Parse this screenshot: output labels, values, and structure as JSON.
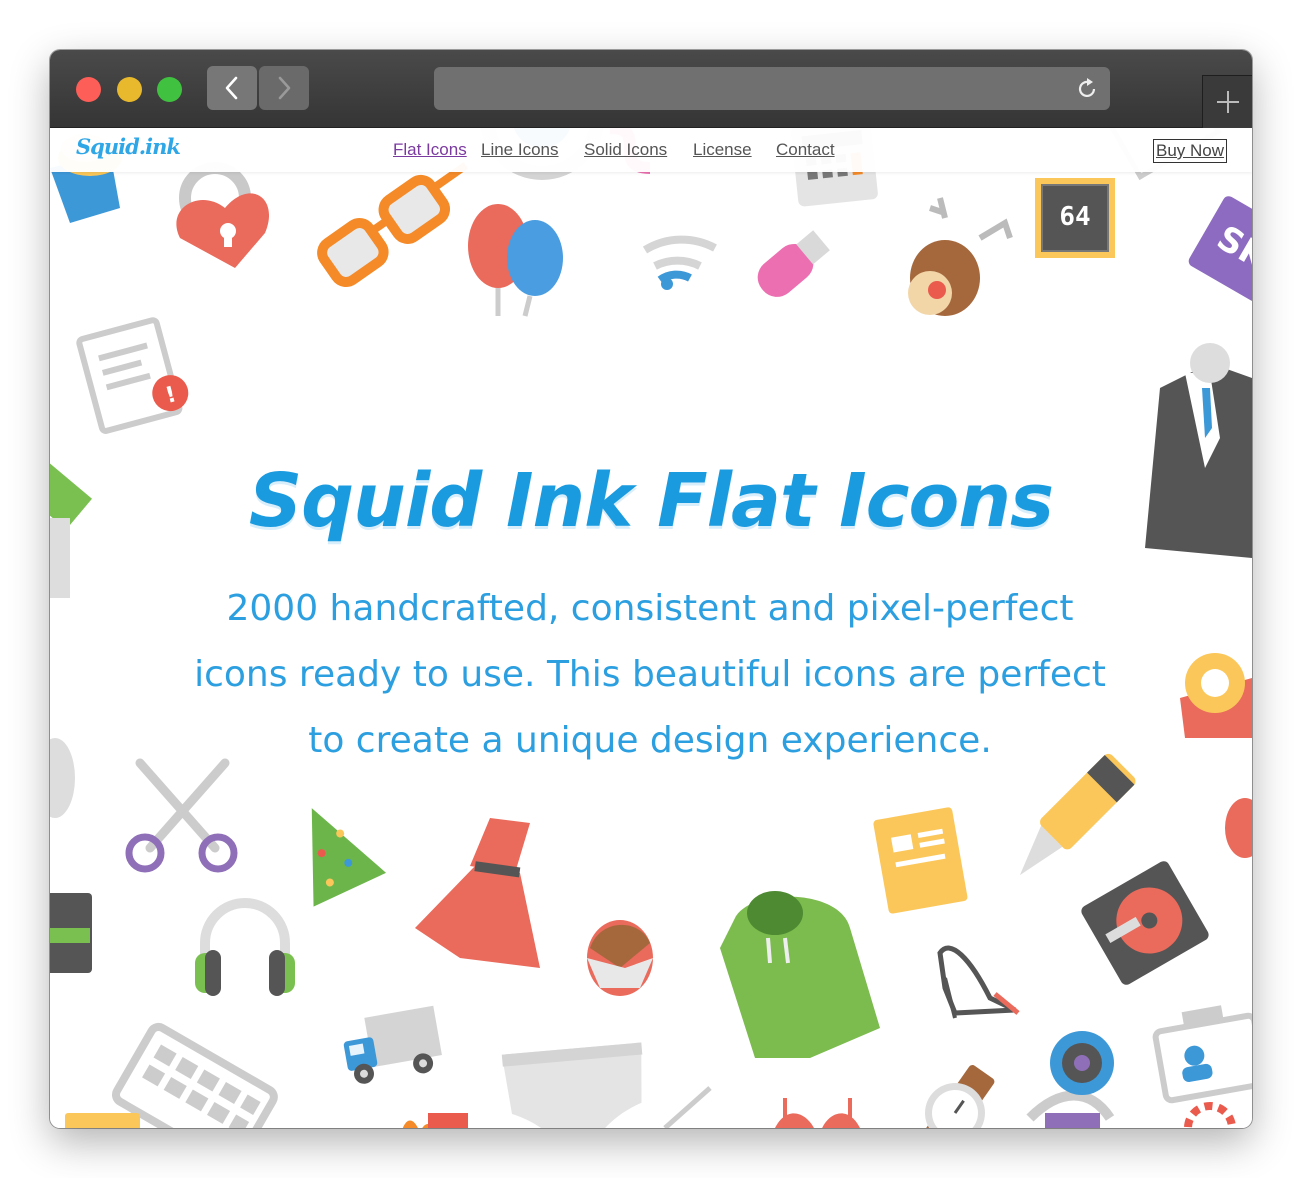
{
  "browser": {
    "url": "",
    "back_icon": "chevron-left-icon",
    "forward_icon": "chevron-right-icon",
    "reload_icon": "reload-icon",
    "new_tab_icon": "plus-icon"
  },
  "site": {
    "logo": "Squid.ink",
    "nav": {
      "flat": "Flat Icons",
      "line": "Line Icons",
      "solid": "Solid Icons",
      "license": "License",
      "contact": "Contact"
    },
    "buy": "Buy Now"
  },
  "hero": {
    "title": "Squid Ink Flat Icons",
    "subtitle": "2000 handcrafted, consistent and pixel-perfect icons ready to use. This beautiful icons are perfect to create a unique design experience."
  },
  "colors": {
    "accent": "#1a9be0",
    "nav_active": "#7b3aa0"
  }
}
